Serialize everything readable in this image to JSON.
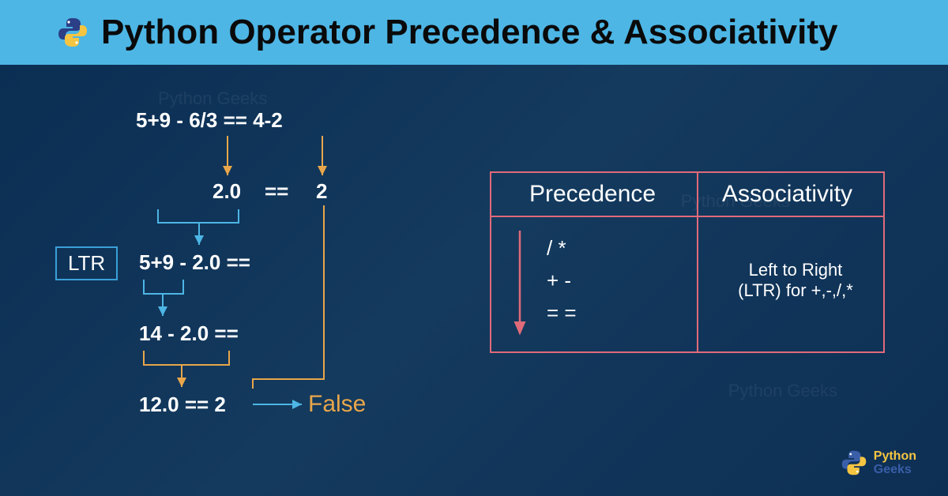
{
  "header": {
    "title": "Python Operator Precedence & Associativity"
  },
  "diagram": {
    "line1": "5+9 - 6/3 == 4-2",
    "line2_left": "2.0",
    "line2_mid": "==",
    "line2_right": "2",
    "ltr_label": "LTR",
    "line3": "5+9 - 2.0  ==",
    "line4": "14 - 2.0   ==",
    "line5": "12.0 == 2",
    "result": "False"
  },
  "table": {
    "col1_header": "Precedence",
    "col2_header": "Associativity",
    "precedence_rows": [
      "/ *",
      "+ -",
      "= ="
    ],
    "associativity_text_1": "Left to Right",
    "associativity_text_2": "(LTR) for +,-,/,*"
  },
  "footer": {
    "brand_line1": "Python",
    "brand_line2": "Geeks"
  }
}
